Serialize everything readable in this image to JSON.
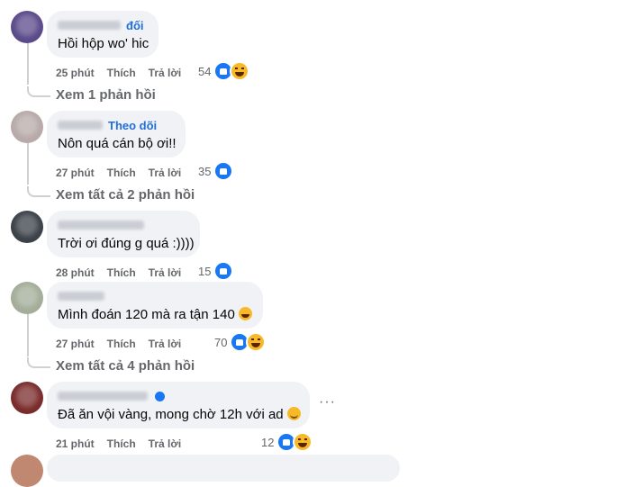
{
  "comments": [
    {
      "follow_label": "đối",
      "text": "Hồi hộp wo' hic",
      "time": "25 phút",
      "like_label": "Thích",
      "reply_label": "Trả lời",
      "reaction_count": "54",
      "reaction_icons": [
        "like-icon",
        "haha-icon"
      ],
      "replies_label": "Xem 1 phản hồi",
      "avatar_color": "#5b4a8a"
    },
    {
      "follow_label": "Theo dõi",
      "text": "Nôn quá cán bộ ơi!!",
      "time": "27 phút",
      "like_label": "Thích",
      "reply_label": "Trả lời",
      "reaction_count": "35",
      "reaction_icons": [
        "like-icon"
      ],
      "replies_label": "Xem tất cả 2 phản hồi",
      "avatar_color": "#b7aaa8"
    },
    {
      "follow_label": "",
      "text": "Trời ơi đúng g quá :))))",
      "time": "28 phút",
      "like_label": "Thích",
      "reply_label": "Trả lời",
      "reaction_count": "15",
      "reaction_icons": [
        "like-icon"
      ],
      "replies_label": "",
      "avatar_color": "#3b4148"
    },
    {
      "follow_label": "",
      "text": "Mình đoán 120 mà ra tận 140",
      "time": "27 phút",
      "like_label": "Thích",
      "reply_label": "Trả lời",
      "reaction_count": "70",
      "reaction_icons": [
        "like-icon",
        "haha-icon"
      ],
      "replies_label": "Xem tất cả 4 phản hồi",
      "avatar_color": "#a3ad98"
    },
    {
      "follow_label": "",
      "text": "Đã ăn vội vàng, mong chờ 12h với ad",
      "time": "21 phút",
      "like_label": "Thích",
      "reply_label": "Trả lời",
      "reaction_count": "12",
      "reaction_icons": [
        "like-icon",
        "haha-icon"
      ],
      "replies_label": "",
      "avatar_color": "#7a2b2b",
      "more_label": "···"
    }
  ],
  "colors": {
    "bubble_bg": "#f0f2f5",
    "meta_text": "#65676b",
    "follow_blue": "#216fdb",
    "like_blue": "#1877f2",
    "haha_yellow": "#f7b928"
  }
}
